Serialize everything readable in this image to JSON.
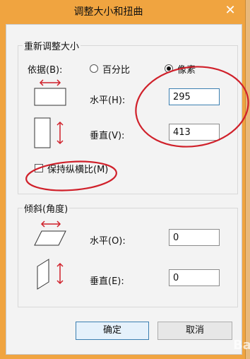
{
  "window": {
    "title": "调整大小和扭曲",
    "close_symbol": "✕"
  },
  "resize": {
    "group_label": "重新调整大小",
    "basis_label": "依据(B):",
    "option_percent": "百分比",
    "option_pixels": "像素",
    "selected": "pixels",
    "horizontal_label": "水平(H):",
    "horizontal_value": "295",
    "vertical_label": "垂直(V):",
    "vertical_value": "413",
    "keep_ratio_label": "保持纵横比(M)",
    "keep_ratio_checked": false
  },
  "skew": {
    "group_label": "倾斜(角度)",
    "horizontal_label": "水平(O):",
    "horizontal_value": "0",
    "vertical_label": "垂直(E):",
    "vertical_value": "0"
  },
  "buttons": {
    "ok_label": "确定",
    "cancel_label": "取消"
  },
  "colors": {
    "title_bar": "#f0a440",
    "annotation": "#d0202a",
    "arrow": "#d0202a"
  },
  "icons": {
    "resize_horizontal": "resize-horizontal-icon",
    "resize_vertical": "resize-vertical-icon",
    "skew_horizontal": "skew-horizontal-icon",
    "skew_vertical": "skew-vertical-icon"
  },
  "watermark": "Ba"
}
